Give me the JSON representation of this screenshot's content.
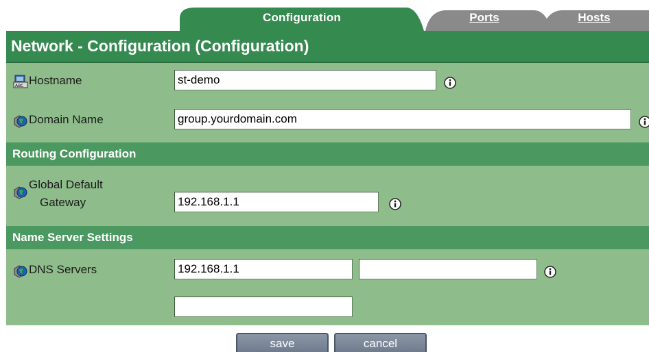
{
  "tabs": {
    "configuration": "Configuration",
    "ports": "Ports",
    "hosts": "Hosts"
  },
  "page_title": "Network - Configuration (Configuration)",
  "fields": {
    "hostname": {
      "label": "Hostname",
      "value": "st-demo"
    },
    "domain_name": {
      "label": "Domain Name",
      "value": "group.yourdomain.com"
    },
    "gateway": {
      "label_line1": "Global Default",
      "label_line2": "Gateway",
      "value": "192.168.1.1"
    },
    "dns": {
      "label": "DNS Servers",
      "value1": "192.168.1.1",
      "value2": "",
      "value3": ""
    }
  },
  "sections": {
    "routing": "Routing Configuration",
    "name_server": "Name Server Settings"
  },
  "buttons": {
    "save": "save",
    "cancel": "cancel"
  },
  "colors": {
    "title_bar": "#358a50",
    "section_bar": "#4b9860",
    "panel": "#8fbc8b",
    "inactive_tab": "#8a8a8a",
    "button": "#7a8699"
  },
  "icons": {
    "hostname": "computer-abc-icon",
    "domain": "globe-cube-icon",
    "info": "info-icon"
  }
}
